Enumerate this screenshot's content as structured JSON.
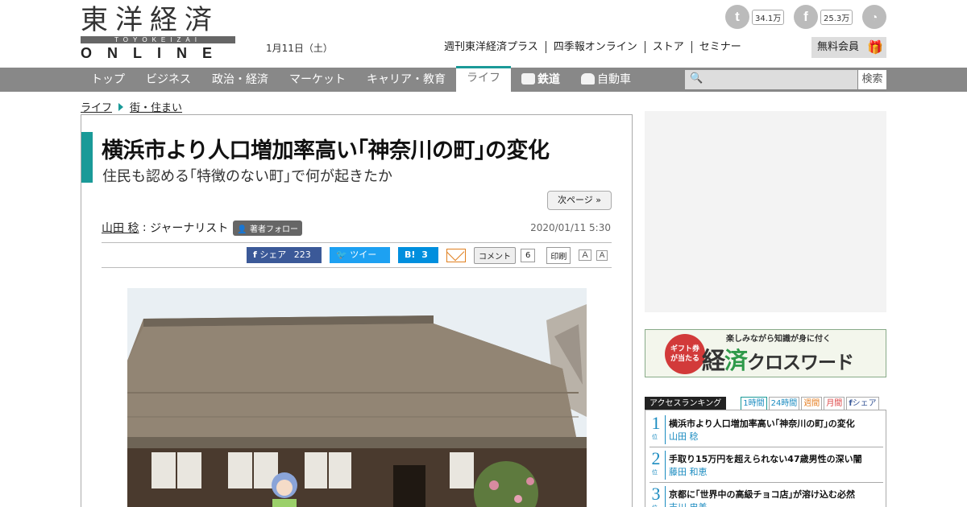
{
  "header": {
    "logo_jp": "東洋経済",
    "logo_band": "TOYOKEIZAI",
    "logo_online": "ONLINE",
    "date": "1月11日（土）",
    "social": [
      {
        "icon": "twitter-icon",
        "count": "34.1万"
      },
      {
        "icon": "facebook-icon",
        "count": "25.3万"
      },
      {
        "icon": "rss-icon",
        "count": ""
      }
    ],
    "links": [
      "週刊東洋経済プラス",
      "四季報オンライン",
      "ストア",
      "セミナー"
    ],
    "member_button": "無料会員"
  },
  "nav": {
    "items": [
      {
        "label": "トップ",
        "active": false
      },
      {
        "label": "ビジネス",
        "active": false
      },
      {
        "label": "政治・経済",
        "active": false
      },
      {
        "label": "マーケット",
        "active": false
      },
      {
        "label": "キャリア・教育",
        "active": false
      },
      {
        "label": "ライフ",
        "active": true
      },
      {
        "label": "鉄道",
        "active": false,
        "icon": "train-icon"
      },
      {
        "label": "自動車",
        "active": false,
        "icon": "car-icon"
      }
    ],
    "search_placeholder": "",
    "search_button": "検索"
  },
  "breadcrumb": [
    "ライフ",
    "街・住まい"
  ],
  "article": {
    "title": "横浜市より人口増加率高い｢神奈川の町｣の変化",
    "subtitle": "住民も認める｢特徴のない町｣で何が起きたか",
    "next_page": "次ページ »",
    "author": "山田 稔",
    "author_role": "ジャーナリスト",
    "follow_label": "著者フォロー",
    "published": "2020/01/11 5:30",
    "share": {
      "facebook_label": "シェア",
      "facebook_count": "223",
      "twitter_label": "ツイート",
      "hatena_label": "B!",
      "hatena_count": "3",
      "comment_label": "コメント",
      "comment_count": "6",
      "print_label": "印刷",
      "font_large": "A",
      "font_small": "A"
    }
  },
  "banner": {
    "badge_line1": "ギフト券",
    "badge_line2": "が当たる",
    "tagline": "楽しみながら知識が身に付く",
    "title_a": "経",
    "title_b": "済",
    "title_c": "クロスワード"
  },
  "ranking": {
    "label": "アクセスランキング",
    "tabs": [
      "1時間",
      "24時間",
      "週間",
      "月間",
      "シェア"
    ],
    "position_suffix": "位",
    "items": [
      {
        "rank": "1",
        "title": "横浜市より人口増加率高い｢神奈川の町｣の変化",
        "author": "山田 稔"
      },
      {
        "rank": "2",
        "title": "手取り15万円を超えられない47歳男性の深い闇",
        "author": "藤田 和恵"
      },
      {
        "rank": "3",
        "title": "京都に｢世界中の高級チョコ店｣が溶け込む必然",
        "author": "吉川 忠美"
      }
    ]
  },
  "colors": {
    "accent": "#1a9a98",
    "nav_bg": "#888888",
    "facebook": "#3b5998",
    "twitter": "#1da1f2",
    "hatena": "#008fde",
    "rank_blue": "#1a8bc0"
  }
}
